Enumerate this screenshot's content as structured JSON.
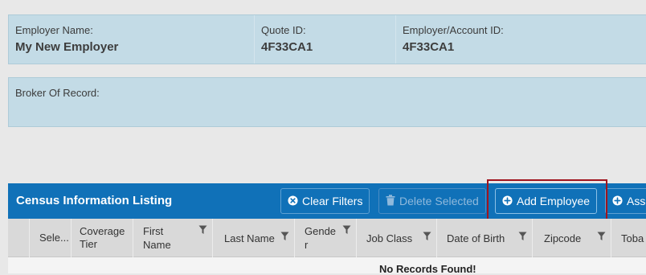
{
  "employer": {
    "name_label": "Employer Name:",
    "name_value": "My New Employer",
    "quote_label": "Quote ID:",
    "quote_value": "4F33CA1",
    "account_label": "Employer/Account ID:",
    "account_value": "4F33CA1"
  },
  "broker": {
    "label": "Broker Of Record:"
  },
  "listing": {
    "title": "Census Information Listing",
    "buttons": {
      "clear_filters": "Clear Filters",
      "delete_selected": "Delete Selected",
      "add_employee": "Add Employee",
      "assign_partial": "Ass"
    }
  },
  "grid": {
    "columns": {
      "select": "Sele...",
      "coverage_1": "Coverage",
      "coverage_2": "Tier",
      "first_1": "First",
      "first_2": "Name",
      "last": "Last Name",
      "gender_1": "Gende",
      "gender_2": "r",
      "jobclass": "Job Class",
      "dob": "Date of Birth",
      "zip": "Zipcode",
      "tobacco": "Toba"
    },
    "empty_message": "No Records Found!"
  },
  "colors": {
    "info_bg": "#c3dbe6",
    "header_blue": "#1071b8",
    "highlight": "#a0141e"
  }
}
